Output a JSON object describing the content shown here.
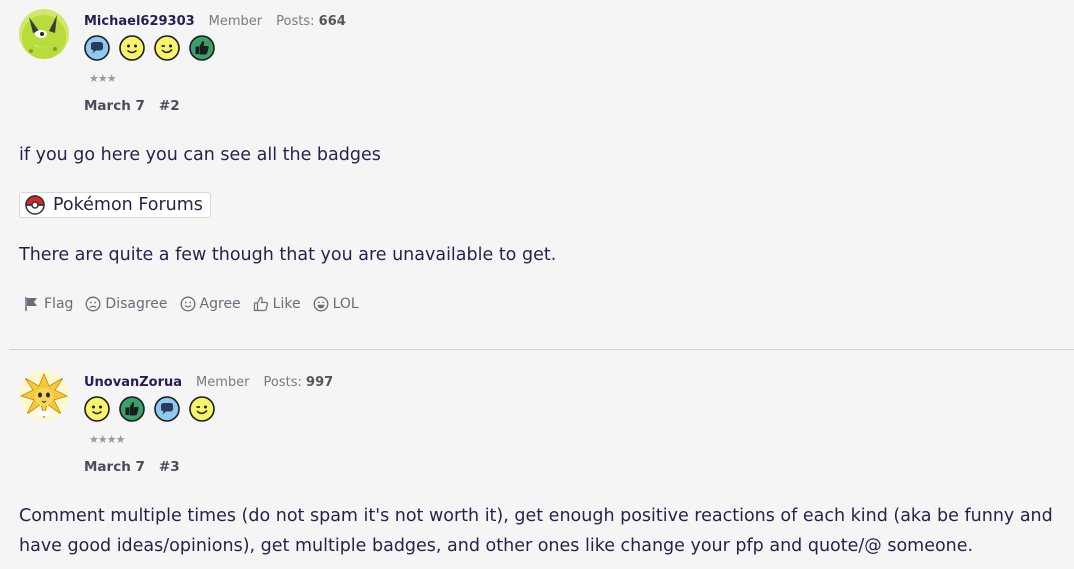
{
  "posts": [
    {
      "username": "Michael629303",
      "user_title": "Member",
      "posts_label": "Posts:",
      "posts_count": "664",
      "badges": [
        "speech-bubble-icon",
        "smiley-icon",
        "wink-icon",
        "thumbs-up-icon"
      ],
      "stars": "★★★",
      "date": "March 7",
      "post_number": "#2",
      "paragraph1": "if you go here you can see all the badges",
      "link_text": "Pokémon Forums",
      "paragraph2": "There are quite a few though that you are unavailable to get.",
      "actions": {
        "flag": "Flag",
        "disagree": "Disagree",
        "agree": "Agree",
        "like": "Like",
        "lol": "LOL"
      }
    },
    {
      "username": "UnovanZorua",
      "user_title": "Member",
      "posts_label": "Posts:",
      "posts_count": "997",
      "badges": [
        "smiley-icon",
        "thumbs-up-icon",
        "speech-bubble-icon",
        "wink-icon"
      ],
      "stars": "★★★★",
      "date": "March 7",
      "post_number": "#3",
      "paragraph1": "Comment multiple times (do not spam it's not worth it), get enough positive reactions of each kind (aka be funny and have good ideas/opinions), get multiple badges, and other ones like change your pfp and quote/@ someone."
    }
  ],
  "colors": {
    "text": "#2a1f4a",
    "username": "#2b1b55",
    "muted": "#7b7b7b",
    "badge_blue": "#8ec9f0",
    "badge_yellow": "#f7f36a",
    "badge_green": "#3aa06a"
  }
}
